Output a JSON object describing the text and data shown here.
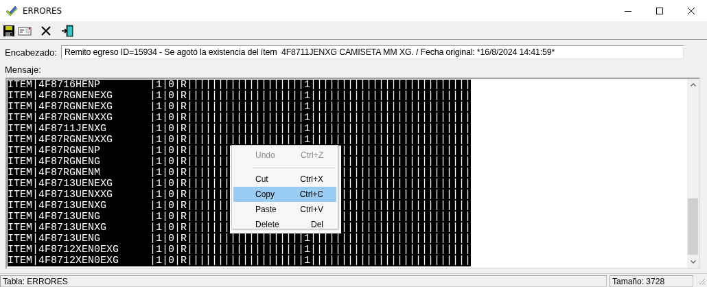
{
  "window": {
    "title": "ERRORES"
  },
  "toolbar": [
    {
      "kind": "save"
    },
    {
      "kind": "card"
    },
    {
      "kind": "delete"
    },
    {
      "kind": "exit"
    }
  ],
  "header": {
    "label": "Encabezado:",
    "value": "Remito egreso ID=15934 - Se agotó la existencia del ítem  4F8711JENXG CAMISETA MM XG. / Fecha original: *16/8/2024 14:41:59*"
  },
  "message": {
    "label": "Mensaje:",
    "lines": [
      [
        "ITEM|4F8716HENP        |1|0|R|||||||||||||||||||1||||||||||||||||||||||||||"
      ],
      [
        "ITEM|4F87RGNENEXG      |1|0|R|||||||||||||||||||1||||||||||||||||||||||||||"
      ],
      [
        "ITEM|4F87RGNENEXG      |1|0|R|||||||||||||||||||1||||||||||||||||||||||||||"
      ],
      [
        "ITEM|4F87RGNENXXG      |1|0|R|||||||||||||||||||1||||||||||||||||||||||||||"
      ],
      [
        "ITEM|4F8711JENXG       |1|0|R|||||||||||||||||||1||||||||||||||||||||||||||"
      ],
      [
        "ITEM|4F87RGNENXXG      |1|0|R|||||||||||||||||||1||||||||||||||||||||||||||"
      ],
      [
        "ITEM|4F87RGNENP        |1|0|R|||||||",
        "|||||||||||||||||||||"
      ],
      [
        "ITEM|4F87RGNENG        |1|0|R|||||||",
        "|||||||||||||||||||||"
      ],
      [
        "ITEM|4F87RGNENM        |1|0|R|||||||",
        "|||||||||||||||||||||"
      ],
      [
        "ITEM|4F8713UENEXG      |1|0|R|||||||",
        "|||||||||||||||||||||"
      ],
      [
        "ITEM|4F8713UENXXG      |1|0|R|||||||",
        "|||||||||||||||||||||"
      ],
      [
        "ITEM|4F8713UENXG       |1|0|R|||||||",
        "|||||||||||||||||||||"
      ],
      [
        "ITEM|4F8713UENG        |1|0|R|||||||",
        "|||||||||||||||||||||"
      ],
      [
        "ITEM|4F8713UENXG       |1|0|R|||||||",
        "|||||||||||||||||||||"
      ],
      [
        "ITEM|4F8713UENG        |1|0|R|||||||||||||||||||1||||||||||||||||||||||||||"
      ],
      [
        "ITEM|4F8712XEN0EXG     |1|0|R|||||||||||||||||||1||||||||||||||||||||||||||"
      ],
      [
        "ITEM|4F8712XEN0EXG     |1|0|R|||||||||||||||||||1||||||||||||||||||||||||||"
      ]
    ]
  },
  "context_menu": [
    {
      "kind": "item",
      "label": "Undo",
      "shortcut": "Ctrl+Z",
      "disabled": true,
      "selected": false
    },
    {
      "kind": "separator"
    },
    {
      "kind": "item",
      "label": "Cut",
      "shortcut": "Ctrl+X",
      "disabled": false,
      "selected": false
    },
    {
      "kind": "item",
      "label": "Copy",
      "shortcut": "Ctrl+C",
      "disabled": false,
      "selected": true
    },
    {
      "kind": "item",
      "label": "Paste",
      "shortcut": "Ctrl+V",
      "disabled": false,
      "selected": false
    },
    {
      "kind": "item",
      "label": "Delete",
      "shortcut": "Del",
      "disabled": false,
      "selected": false
    }
  ],
  "status_bar": {
    "table": "Tabla: ERRORES",
    "size": "Tamaño: 3728"
  }
}
